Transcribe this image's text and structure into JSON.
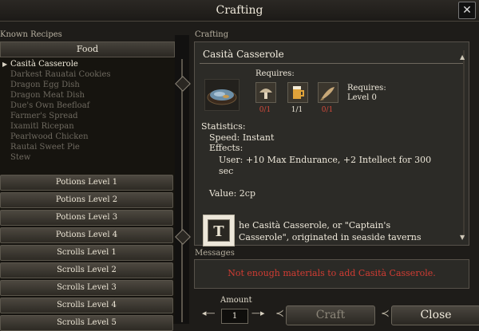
{
  "window": {
    "title": "Crafting",
    "close_glyph": "✕"
  },
  "left": {
    "section_label": "Known Recipes",
    "active_category": "Food",
    "recipes": [
      "Casità Casserole",
      "Darkest Rauatai Cookies",
      "Dragon Egg Dish",
      "Dragon Meat Dish",
      "Due's Own Beefloaf",
      "Farmer's Spread",
      "Ixamitl Ricepan",
      "Pearlwood Chicken",
      "Rautai Sweet Pie",
      "Stew"
    ],
    "selected_index": 0,
    "categories": [
      "Potions Level 1",
      "Potions Level 2",
      "Potions Level 3",
      "Potions Level 4",
      "Scrolls Level 1",
      "Scrolls Level 2",
      "Scrolls Level 3",
      "Scrolls Level 4",
      "Scrolls Level 5"
    ]
  },
  "crafting": {
    "section_label": "Crafting",
    "recipe_name": "Casità Casserole",
    "requires_label": "Requires:",
    "requires_level_label": "Requires:",
    "requires_level_value": "Level 0",
    "ingredients": [
      {
        "icon": "mushroom-icon",
        "count": "0/1",
        "status": "missing"
      },
      {
        "icon": "ale-mug-icon",
        "count": "1/1",
        "status": "ok"
      },
      {
        "icon": "fish-icon",
        "count": "0/1",
        "status": "missing"
      }
    ],
    "statistics_label": "Statistics:",
    "speed_line": "Speed: Instant",
    "effects_label": "Effects:",
    "effect_line1": "User: +10 Max Endurance, +2 Intellect for 300",
    "effect_line2": "sec",
    "value_line": "Value: 2cp",
    "description_line1": "he Casità Casserole, or \"Captain's",
    "description_line2": "Casserole\", originated in seaside taverns",
    "illuminated_letter": "T"
  },
  "messages": {
    "section_label": "Messages",
    "text": "Not enough materials to add Casità Casserole."
  },
  "controls": {
    "amount_label": "Amount",
    "amount_value": "1",
    "craft_label": "Craft",
    "close_label": "Close"
  },
  "colors": {
    "error_red": "#d23c33",
    "missing_count": "#d24a3b",
    "panel_bg": "#2c2b27"
  }
}
